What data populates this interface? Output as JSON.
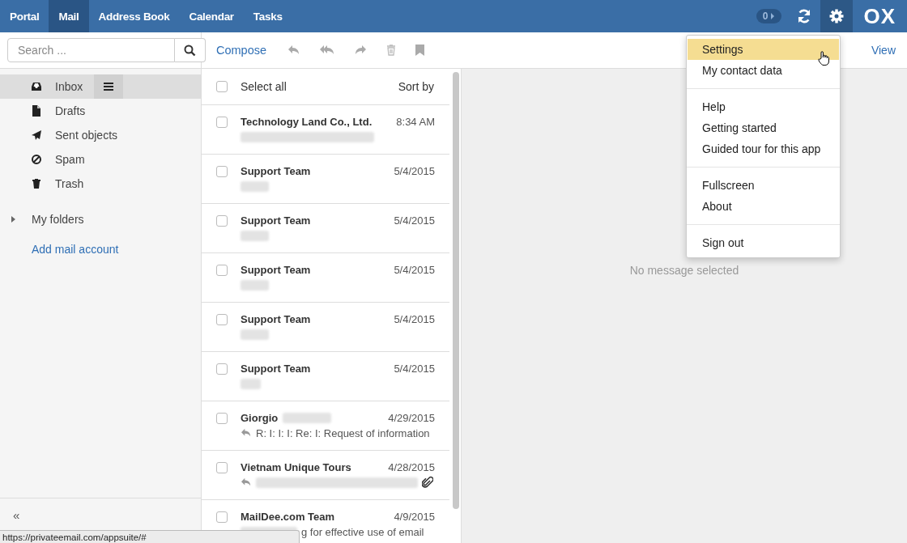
{
  "top_nav": {
    "apps": [
      {
        "label": "Portal",
        "selected": false
      },
      {
        "label": "Mail",
        "selected": true
      },
      {
        "label": "Address Book",
        "selected": false
      },
      {
        "label": "Calendar",
        "selected": false
      },
      {
        "label": "Tasks",
        "selected": false
      }
    ],
    "badge": "0",
    "logo": "OX"
  },
  "search": {
    "placeholder": "Search ..."
  },
  "folders": [
    {
      "name": "Inbox",
      "selected": true
    },
    {
      "name": "Drafts",
      "selected": false
    },
    {
      "name": "Sent objects",
      "selected": false
    },
    {
      "name": "Spam",
      "selected": false
    },
    {
      "name": "Trash",
      "selected": false
    }
  ],
  "my_folders": {
    "label": "My folders",
    "expanded": false
  },
  "add_account": "Add mail account",
  "collapse": "«",
  "toolbar": {
    "compose": "Compose",
    "view": "View"
  },
  "list_header": {
    "select_all": "Select all",
    "checked": false,
    "sort_by": "Sort by"
  },
  "messages": [
    {
      "from": "Technology Land Co., Ltd.",
      "name_blurred": false,
      "date": "8:34 AM",
      "checked": false,
      "replied": false,
      "attachment": false,
      "subject_blurred": true
    },
    {
      "from": "Support Team",
      "name_blurred": false,
      "date": "5/4/2015",
      "checked": false,
      "replied": false,
      "attachment": false,
      "subject_blurred": true
    },
    {
      "from": "Support Team",
      "name_blurred": false,
      "date": "5/4/2015",
      "checked": false,
      "replied": false,
      "attachment": false,
      "subject_blurred": true
    },
    {
      "from": "Support Team",
      "name_blurred": false,
      "date": "5/4/2015",
      "checked": false,
      "replied": false,
      "attachment": false,
      "subject_blurred": true
    },
    {
      "from": "Support Team",
      "name_blurred": false,
      "date": "5/4/2015",
      "checked": false,
      "replied": false,
      "attachment": false,
      "subject_blurred": true
    },
    {
      "from": "Support Team",
      "name_blurred": false,
      "date": "5/4/2015",
      "checked": false,
      "replied": false,
      "attachment": false,
      "subject_blurred": true
    },
    {
      "from": "Giorgio",
      "name_blurred": true,
      "date": "4/29/2015",
      "checked": false,
      "replied": true,
      "attachment": false,
      "subject_blurred": false,
      "subject": "R: I: I: I: Re: I: Request of information"
    },
    {
      "from": "Vietnam Unique Tours",
      "name_blurred": false,
      "date": "4/28/2015",
      "checked": false,
      "replied": true,
      "attachment": true,
      "subject_blurred": true
    },
    {
      "from": "MailDee.com Team",
      "name_blurred": false,
      "date": "4/9/2015",
      "checked": false,
      "replied": false,
      "attachment": false,
      "subject_blurred": true,
      "subject": "g for effective use of email"
    }
  ],
  "empty_message": "No message selected",
  "settings_menu": [
    [
      {
        "label": "Settings",
        "selected": true
      },
      {
        "label": "My contact data",
        "selected": false
      }
    ],
    [
      {
        "label": "Help",
        "selected": false
      },
      {
        "label": "Getting started",
        "selected": false
      },
      {
        "label": "Guided tour for this app",
        "selected": false
      }
    ],
    [
      {
        "label": "Fullscreen",
        "selected": false
      },
      {
        "label": "About",
        "selected": false
      }
    ],
    [
      {
        "label": "Sign out",
        "selected": false
      }
    ]
  ],
  "status_url": "https://privateemail.com/appsuite/#"
}
